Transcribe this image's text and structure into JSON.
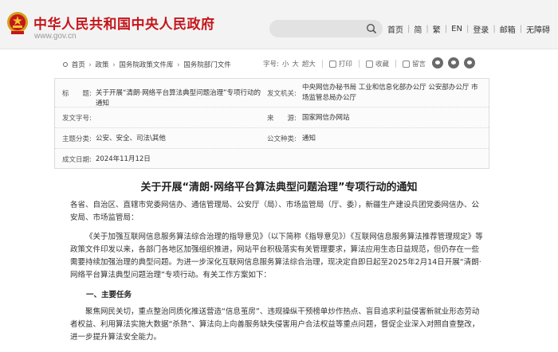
{
  "header": {
    "site_title": "中华人民共和国中央人民政府",
    "site_url": "www.gov.cn",
    "nav": [
      "首页",
      "简",
      "繁",
      "EN",
      "登录",
      "邮箱",
      "无障碍"
    ],
    "search_placeholder": ""
  },
  "breadcrumb": {
    "items": [
      "首页",
      "政策",
      "国务院政策文件库",
      "国务院部门文件"
    ]
  },
  "tools": {
    "font_size_label": "字号:",
    "font_sizes": [
      "小",
      "大",
      "超大"
    ],
    "print": "打印",
    "favorite": "收藏",
    "comment": "留言"
  },
  "meta": {
    "title_label": "标　　题:",
    "title_value": "关于开展“清朗·网络平台算法典型问题治理”专项行动的通知",
    "issuer_label": "发文机关:",
    "issuer_value": "中央网信办秘书局 工业和信息化部办公厅 公安部办公厅 市场监管总局办公厅",
    "doc_no_label": "发文字号:",
    "doc_no_value": "",
    "source_label": "来　　源:",
    "source_value": "国家网信办网站",
    "category_label": "主题分类:",
    "category_value": "公安、安全、司法\\其他",
    "doc_type_label": "公文种类:",
    "doc_type_value": "通知",
    "date_label": "成文日期:",
    "date_value": "2024年11月12日"
  },
  "article": {
    "title": "关于开展“清朗·网络平台算法典型问题治理”专项行动的通知",
    "addressees": "各省、自治区、直辖市党委网信办、通信管理局、公安厅（局）、市场监管局（厅、委），新疆生产建设兵团党委网信办、公安局、市场监管局：",
    "intro": "《关于加强互联网信息服务算法综合治理的指导意见》（以下简称《指导意见》）《互联网信息服务算法推荐管理规定》等政策文件印发以来，各部门各地区加强组织推进，网站平台积极落实有关管理要求，算法应用生态日益规范，但仍存在一些需要持续加强治理的典型问题。为进一步深化互联网信息服务算法综合治理，现决定自即日起至2025年2月14日开展“清朗·网络平台算法典型问题治理”专项行动。有关工作方案如下：",
    "section1_heading": "一、主要任务",
    "section1_text": "聚焦网民关切，重点整治同质化推送营造“信息茧房”、违规操纵干预榜单炒作热点、盲目追求利益侵害新就业形态劳动者权益、利用算法实施大数据“杀熟”、算法向上向善服务缺失侵害用户合法权益等重点问题，督促企业深入对照自查整改，进一步提升算法安全能力。"
  },
  "colors": {
    "brand_red": "#c4161c",
    "header_bg": "#f3f3f3"
  }
}
